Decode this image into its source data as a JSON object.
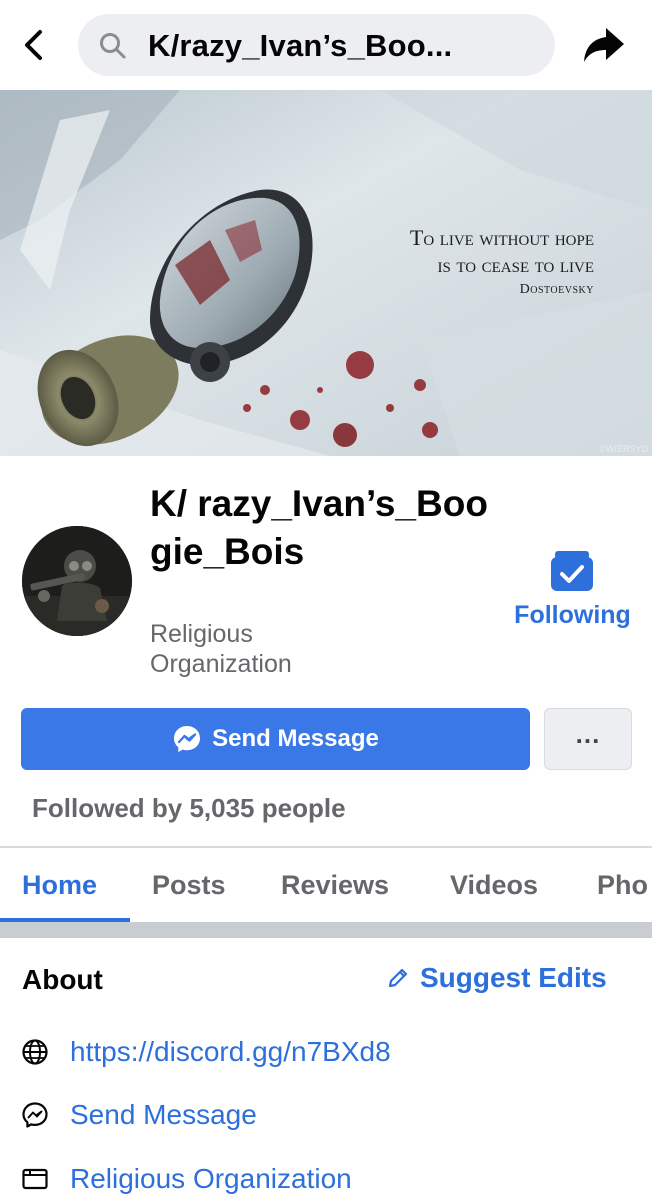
{
  "topbar": {
    "search_text": "K/razy_Ivan’s_Boo..."
  },
  "cover": {
    "quote_line1": "To live without hope",
    "quote_line2": "is to cease to live",
    "quote_author": "Dostoevsky",
    "watermark": "©WIERSYD"
  },
  "profile": {
    "name": "K/ razy_Ivan’s_Boogie_Bois",
    "category": "Religious Organization",
    "follow_status": "Following",
    "send_message_label": "Send Message",
    "more_label": "...",
    "followed_by": "Followed by 5,035 people"
  },
  "tabs": [
    {
      "label": "Home",
      "active": true
    },
    {
      "label": "Posts",
      "active": false
    },
    {
      "label": "Reviews",
      "active": false
    },
    {
      "label": "Videos",
      "active": false
    },
    {
      "label": "Pho",
      "active": false
    }
  ],
  "about": {
    "title": "About",
    "suggest_edits": "Suggest Edits",
    "items": [
      {
        "icon": "globe-icon",
        "text": "https://discord.gg/n7BXd8"
      },
      {
        "icon": "messenger-icon",
        "text": "Send Message"
      },
      {
        "icon": "category-icon",
        "text": "Religious Organization"
      }
    ]
  },
  "colors": {
    "accent": "#2d6fdb",
    "button_blue": "#3b78e7",
    "muted_text": "#65676b",
    "section_gap": "#c9ccd1"
  }
}
